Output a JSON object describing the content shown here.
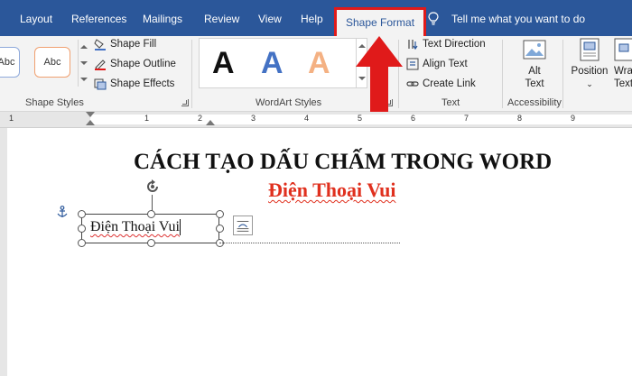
{
  "tabs": [
    "Layout",
    "References",
    "Mailings",
    "Review",
    "View",
    "Help"
  ],
  "active_tab": "Shape Format",
  "tell_me": "Tell me what you want to do",
  "ribbon": {
    "shape_styles": {
      "presets": [
        "Abc",
        "Abc"
      ],
      "fill": "Shape Fill",
      "outline": "Shape Outline",
      "effects": "Shape Effects",
      "label": "Shape Styles"
    },
    "wordart": {
      "letters": [
        "A",
        "A",
        "A"
      ],
      "colors": [
        "#111111",
        "#4472c4",
        "#f4b183"
      ],
      "label": "WordArt Styles"
    },
    "text": {
      "direction": "Text Direction",
      "align": "Align Text",
      "link": "Create Link",
      "label": "Text"
    },
    "accessibility": {
      "alt_text_line1": "Alt",
      "alt_text_line2": "Text",
      "label": "Accessibility"
    },
    "arrange": {
      "position": "Position",
      "wrap_line1": "Wra",
      "wrap_line2": "Text"
    }
  },
  "ruler": {
    "numbers": [
      "1",
      "1",
      "2",
      "3",
      "4",
      "5",
      "6",
      "7",
      "8",
      "9"
    ]
  },
  "document": {
    "title": "CÁCH TẠO DẤU CHẤM TRONG WORD",
    "subtitle": "Điện Thoại Vui",
    "textbox_text": "Điện Thoại Vui"
  },
  "colors": {
    "ribbon_blue": "#2b579a",
    "highlight_red": "#e01a1a",
    "subtitle_red": "#e0301e"
  },
  "icons": [
    "lightbulb-icon",
    "shape-fill-icon",
    "shape-outline-icon",
    "shape-effects-icon",
    "text-direction-icon",
    "align-text-icon",
    "create-link-icon",
    "alt-text-icon",
    "position-icon",
    "wrap-text-icon",
    "rotate-handle-icon",
    "anchor-icon",
    "layout-options-icon",
    "red-arrow"
  ]
}
